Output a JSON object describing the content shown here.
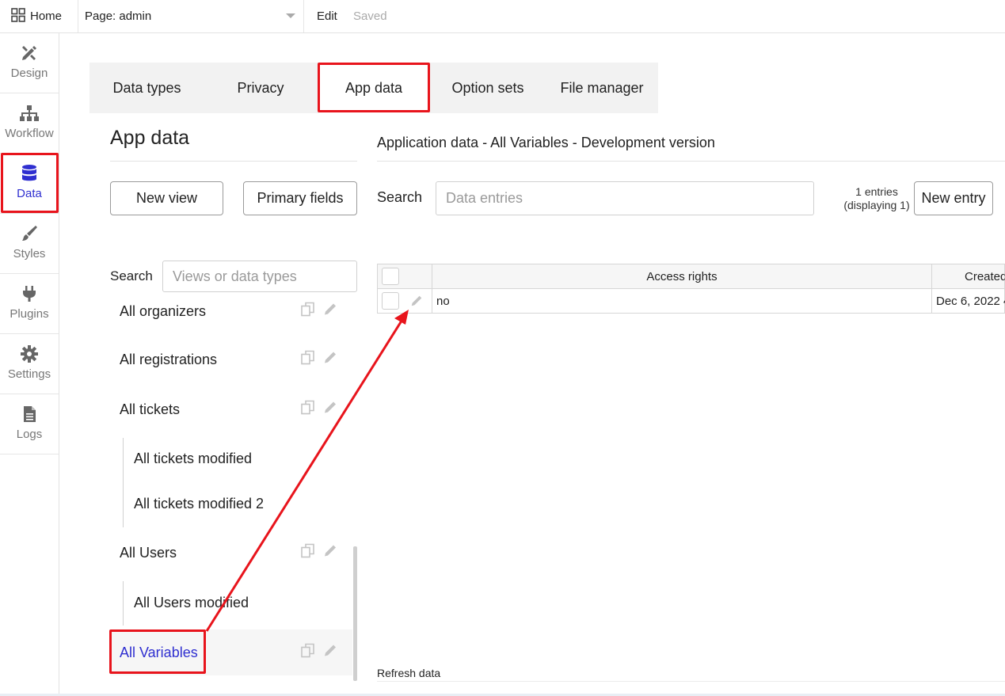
{
  "topbar": {
    "home_label": "Home",
    "page_select": "Page: admin",
    "edit_label": "Edit",
    "saved_label": "Saved"
  },
  "sidebar": {
    "items": [
      {
        "label": "Design",
        "icon": "design-icon"
      },
      {
        "label": "Workflow",
        "icon": "workflow-icon"
      },
      {
        "label": "Data",
        "icon": "database-icon"
      },
      {
        "label": "Styles",
        "icon": "brush-icon"
      },
      {
        "label": "Plugins",
        "icon": "plug-icon"
      },
      {
        "label": "Settings",
        "icon": "gear-icon"
      },
      {
        "label": "Logs",
        "icon": "document-icon"
      }
    ],
    "active": "Data"
  },
  "tabs": [
    {
      "label": "Data types"
    },
    {
      "label": "Privacy"
    },
    {
      "label": "App data"
    },
    {
      "label": "Option sets"
    },
    {
      "label": "File manager"
    }
  ],
  "left": {
    "title": "App data",
    "new_view_button": "New view",
    "primary_fields_button": "Primary fields",
    "search_label": "Search",
    "search_placeholder": "Views or data types",
    "views": [
      {
        "label": "All organizers"
      },
      {
        "label": "All registrations"
      },
      {
        "label": "All tickets"
      },
      {
        "label": "All tickets modified"
      },
      {
        "label": "All tickets modified 2"
      },
      {
        "label": "All Users"
      },
      {
        "label": "All Users modified"
      },
      {
        "label": "All Variables"
      }
    ]
  },
  "right": {
    "heading": "Application data - All Variables - Development version",
    "search_label": "Search",
    "search_placeholder": "Data entries",
    "entries_count": "1 entries (displaying 1)",
    "new_entry_button": "New entry",
    "columns": [
      "Access rights",
      "Created"
    ],
    "rows": [
      {
        "access_rights": "no",
        "created": "Dec 6, 2022 4"
      }
    ],
    "refresh_label": "Refresh data"
  },
  "colors": {
    "accent": "#2f2fd0",
    "annotation": "#e8141c"
  }
}
